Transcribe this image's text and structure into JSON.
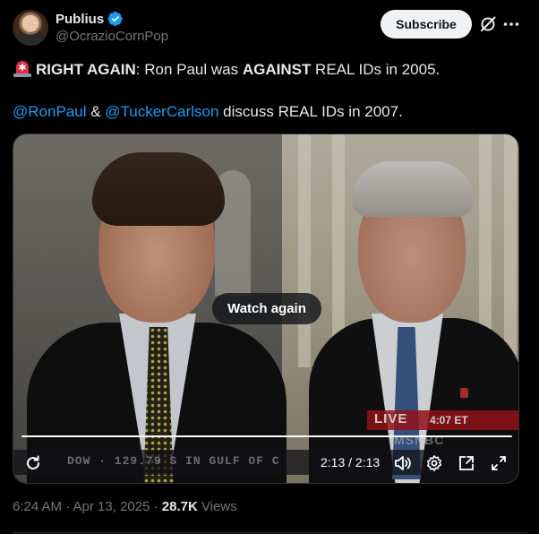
{
  "author": {
    "name": "Publius",
    "handle": "@OcrazioCornPop",
    "verified": true
  },
  "actions": {
    "subscribe_label": "Subscribe",
    "grok_icon": "grok-icon",
    "more_icon": "more-icon"
  },
  "tweet": {
    "line1_bold1": "RIGHT AGAIN",
    "line1_text1": ":  Ron Paul was ",
    "line1_bold2": "AGAINST",
    "line1_text2": " REAL IDs in 2005.",
    "mention1": "@RonPaul",
    "amp": " & ",
    "mention2": "@TuckerCarlson",
    "line2_text": " discuss REAL IDs in 2007."
  },
  "video": {
    "watch_again_label": "Watch again",
    "time_display": "2:13 / 2:13",
    "progress": 1.0,
    "overlay": {
      "live": "LIVE",
      "live_time": "4:07 ET",
      "network": "MSNBC",
      "ticker": "DOW · 129.79  S  IN GULF OF C"
    }
  },
  "footer": {
    "timestamp": "6:24 AM · Apr 13, 2025 · ",
    "views_count": "28.7K",
    "views_label": " Views"
  },
  "colors": {
    "background": "#000000",
    "text": "#e7e9ea",
    "muted": "#71767b",
    "link": "#1d9bf0",
    "verified": "#1d9bf0"
  }
}
